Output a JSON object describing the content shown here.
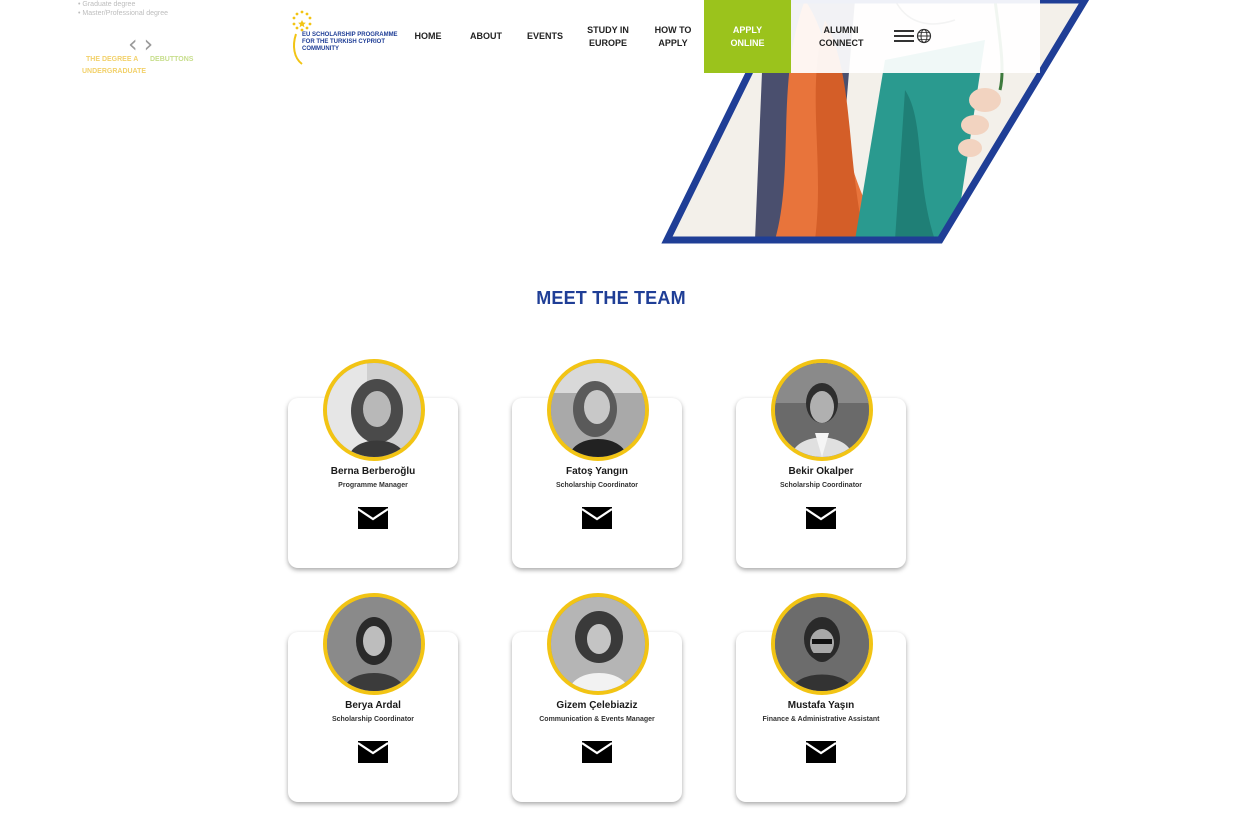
{
  "ghost_sidebar": {
    "lines": [
      "Graduate degree",
      "Master/Professional degree"
    ],
    "label_1": "THE DEGREE A",
    "label_2": "DEBUTTONS",
    "label_3": "UNDERGRADUATE"
  },
  "header": {
    "logo_text": "EU SCHOLARSHIP PROGRAMME FOR THE TURKISH CYPRIOT COMMUNITY",
    "nav": {
      "home": "HOME",
      "about": "ABOUT",
      "events": "EVENTS",
      "study": "STUDY IN EUROPE",
      "how": "HOW TO APPLY",
      "apply": "APPLY ONLINE",
      "alumni": "ALUMNI CONNECT"
    },
    "icons": {
      "menu": "hamburger-icon",
      "language": "globe-icon"
    },
    "accent_color": "#9bc31c"
  },
  "main": {
    "section_title": "MEET THE TEAM",
    "title_color": "#1f3e96",
    "team": [
      {
        "name": "Berna Berberoğlu",
        "role": "Programme Manager"
      },
      {
        "name": "Fatoş Yangın",
        "role": "Scholarship Coordinator"
      },
      {
        "name": "Bekir Okalper",
        "role": "Scholarship Coordinator"
      },
      {
        "name": "Berya Ardal",
        "role": "Scholarship Coordinator"
      },
      {
        "name": "Gizem Çelebiaziz",
        "role": "Communication & Events Manager"
      },
      {
        "name": "Mustafa Yaşın",
        "role": "Finance & Administrative Assistant"
      }
    ],
    "avatar_border_color": "#f2c414"
  }
}
